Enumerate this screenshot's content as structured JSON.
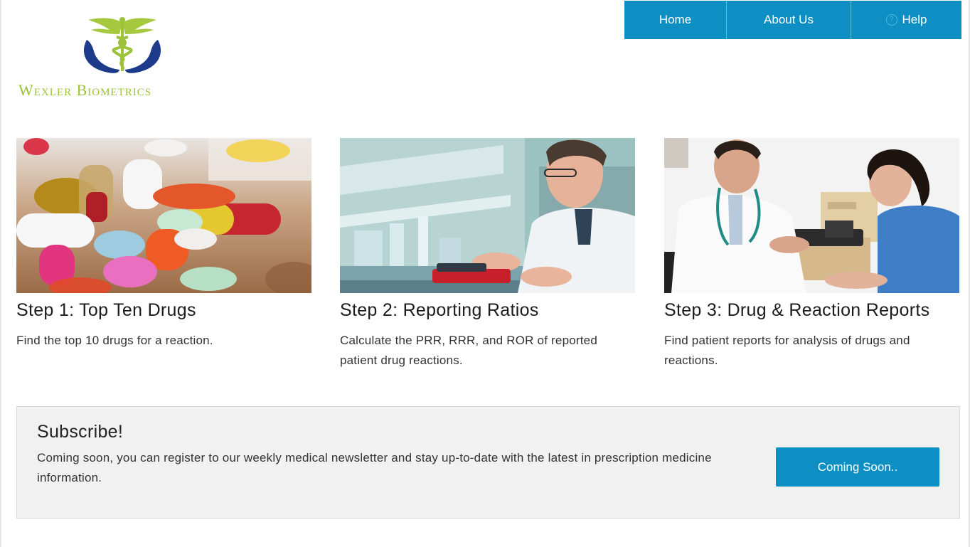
{
  "brand": {
    "name": "Wexler Biometrics",
    "logo_icon": "caduceus-hands-icon",
    "colors": {
      "green": "#9cc23c",
      "navy": "#1e3a8a"
    }
  },
  "nav": {
    "items": [
      {
        "label": "Home"
      },
      {
        "label": "About Us"
      },
      {
        "label": "Help",
        "icon": "question-circle-icon"
      }
    ],
    "color": "#0e8fc3"
  },
  "cards": [
    {
      "title": "Step 1: Top Ten Drugs",
      "text": "Find the top 10 drugs for a reaction.",
      "image": "pills-photo"
    },
    {
      "title": "Step 2: Reporting Ratios",
      "text": "Calculate the PRR, RRR, and ROR of reported patient drug reactions.",
      "image": "lab-scientist-photo"
    },
    {
      "title": "Step 3: Drug & Reaction Reports",
      "text": "Find patient reports for analysis of drugs and reactions.",
      "image": "doctor-patient-photo"
    }
  ],
  "subscribe": {
    "title": "Subscribe!",
    "text": "Coming soon, you can register to our weekly medical newsletter and stay up-to-date with the latest in prescription medicine information.",
    "button_label": "Coming Soon.."
  }
}
